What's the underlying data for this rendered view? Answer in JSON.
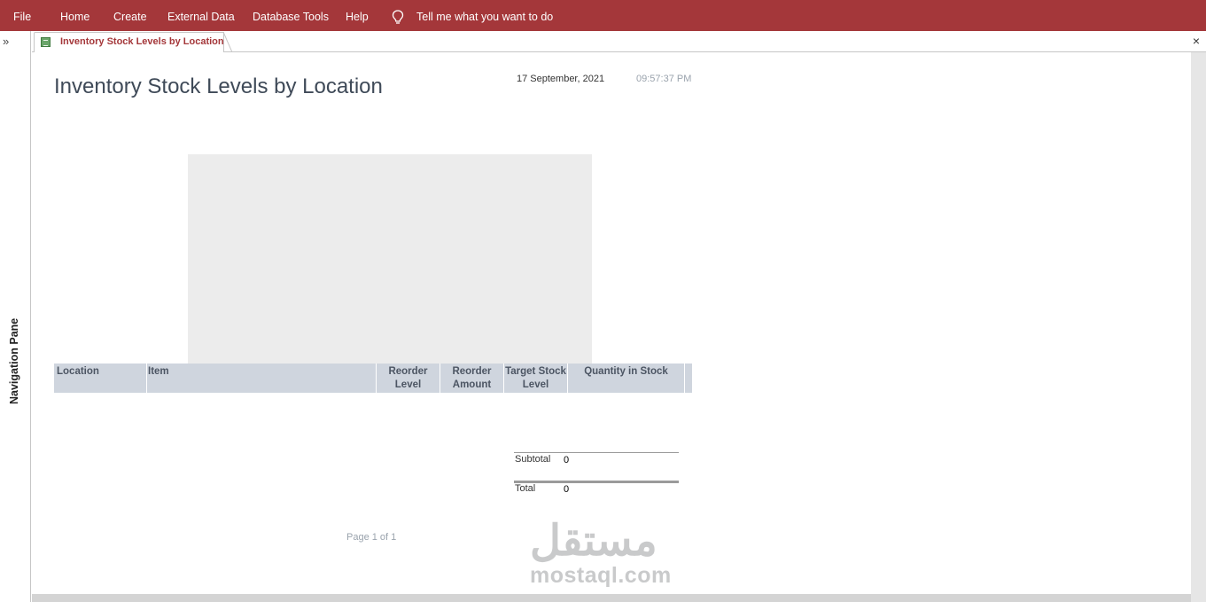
{
  "menu": {
    "file": "File",
    "home": "Home",
    "create": "Create",
    "external_data": "External Data",
    "database_tools": "Database Tools",
    "help": "Help",
    "tell_me": "Tell me what you want to do"
  },
  "nav": {
    "toggle": "»",
    "label": "Navigation Pane"
  },
  "tab": {
    "title": "Inventory Stock Levels by Location",
    "close": "×"
  },
  "report": {
    "title": "Inventory Stock Levels by Location",
    "date": "17 September, 2021",
    "time": "09:57:37 PM",
    "columns": {
      "location": "Location",
      "item": "Item",
      "reorder_level": "Reorder Level",
      "reorder_amount": "Reorder Amount",
      "target_stock_level": "Target Stock Level",
      "quantity_in_stock": "Quantity in Stock"
    },
    "subtotal_label": "Subtotal",
    "subtotal_value": "0",
    "total_label": "Total",
    "total_value": "0",
    "page_info": "Page 1 of 1"
  },
  "watermark": {
    "arabic": "مستقل",
    "latin": "mostaql.com"
  },
  "colors": {
    "ribbon": "#a4373a",
    "header_row": "#cfd5de",
    "chart_placeholder": "#ececec"
  },
  "icons": {
    "tell_me": "lightbulb-icon",
    "tab": "report-icon",
    "close": "close-icon",
    "nav_toggle": "chevron-double-right-icon"
  }
}
